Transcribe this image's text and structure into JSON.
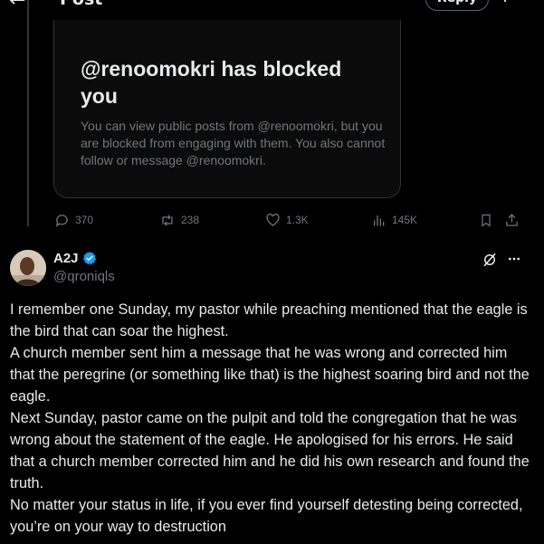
{
  "header": {
    "title": "Post",
    "reply_label": "Reply"
  },
  "blocked_card": {
    "title": "@renoomokri has blocked you",
    "description": "You can view public posts from @renoomokri, but you are blocked from engaging with them. You also cannot follow or message @renoomokri."
  },
  "actions": {
    "replies": "370",
    "reposts": "238",
    "likes": "1.3K",
    "views": "145K"
  },
  "post": {
    "display_name": "A2J",
    "handle": "@qroniqls",
    "lines": [
      "I remember one Sunday, my pastor while preaching mentioned that the eagle is the bird that can soar the highest.",
      "A church member sent him a message that he was wrong and corrected him that the peregrine (or something like that) is the highest soaring bird and not the eagle.",
      "Next Sunday, pastor came on the pulpit and told the congregation that he was wrong about the  statement of the eagle. He apologised for his errors. He said that a church member corrected him and he did his own research and found the truth.",
      "No matter your status in life, if you ever find yourself detesting being corrected, you’re on your way to destruction"
    ]
  },
  "colors": {
    "background": "#000000",
    "text": "#e7e9ea",
    "muted": "#71767b",
    "verified": "#1d9bf0",
    "border": "#2f3336"
  }
}
